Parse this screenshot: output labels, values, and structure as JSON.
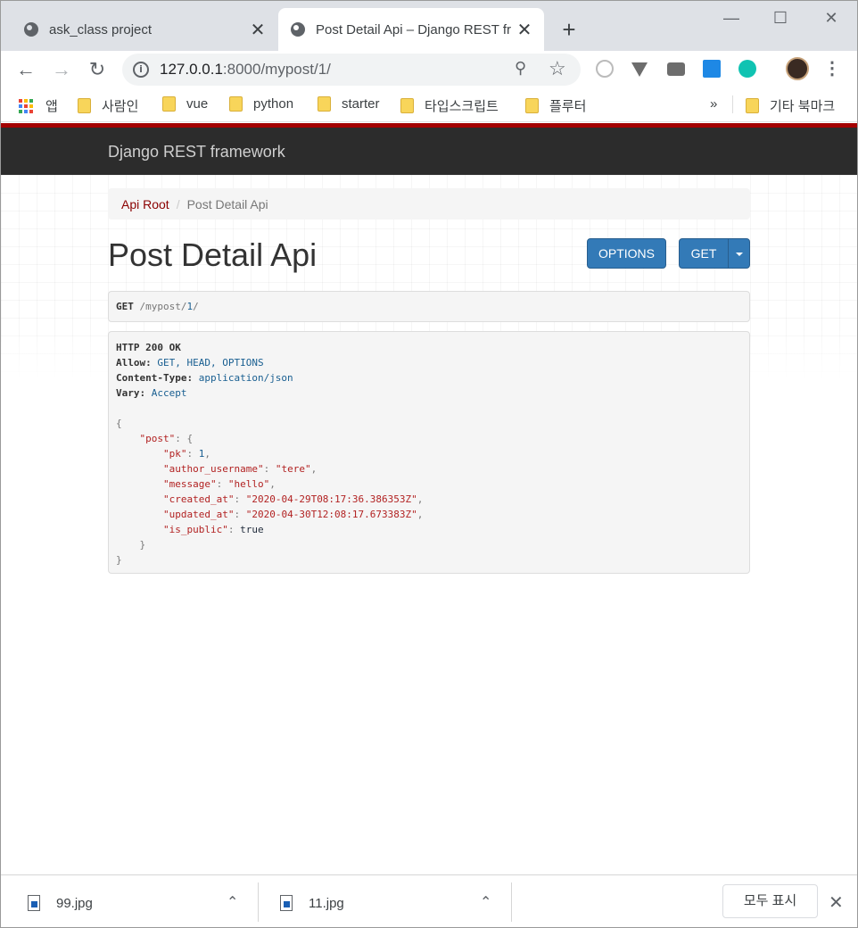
{
  "browser": {
    "tabs": [
      {
        "title": "ask_class project",
        "active": false
      },
      {
        "title": "Post Detail Api – Django REST fr",
        "active": true
      }
    ],
    "new_tab": "+",
    "window_controls": {
      "minimize": "—",
      "maximize": "☐",
      "close": "✕"
    },
    "url_host": "127.0.0.1",
    "url_rest": ":8000/mypost/1/",
    "bookmarks": [
      "앱",
      "사람인",
      "vue",
      "python",
      "starter",
      "타입스크립트",
      "플루터"
    ],
    "bookmarks_more": "»",
    "other_bookmarks": "기타 북마크"
  },
  "page": {
    "brand": "Django REST framework",
    "breadcrumb": {
      "root": "Api Root",
      "separator": "/",
      "current": "Post Detail Api"
    },
    "title": "Post Detail Api",
    "buttons": {
      "options": "OPTIONS",
      "get": "GET"
    },
    "request": {
      "method": "GET",
      "path_prefix": "/mypost/",
      "path_id": "1",
      "path_suffix": "/"
    },
    "response": {
      "status": "HTTP 200 OK",
      "headers": [
        {
          "name": "Allow:",
          "value": "GET, HEAD, OPTIONS"
        },
        {
          "name": "Content-Type:",
          "value": "application/json"
        },
        {
          "name": "Vary:",
          "value": "Accept"
        }
      ],
      "body": {
        "root_key": "\"post\"",
        "fields": [
          {
            "key": "\"pk\"",
            "value": "1",
            "type": "num"
          },
          {
            "key": "\"author_username\"",
            "value": "\"tere\"",
            "type": "str"
          },
          {
            "key": "\"message\"",
            "value": "\"hello\"",
            "type": "str"
          },
          {
            "key": "\"created_at\"",
            "value": "\"2020-04-29T08:17:36.386353Z\"",
            "type": "str"
          },
          {
            "key": "\"updated_at\"",
            "value": "\"2020-04-30T12:08:17.673383Z\"",
            "type": "str"
          },
          {
            "key": "\"is_public\"",
            "value": "true",
            "type": "kw"
          }
        ]
      }
    }
  },
  "downloads": {
    "items": [
      "99.jpg",
      "11.jpg"
    ],
    "show_all": "모두 표시",
    "close": "✕"
  },
  "colors": {
    "brand_red": "#a30000",
    "navbar": "#2c2c2c",
    "button_blue": "#337ab7",
    "link_red": "#8b0000"
  }
}
